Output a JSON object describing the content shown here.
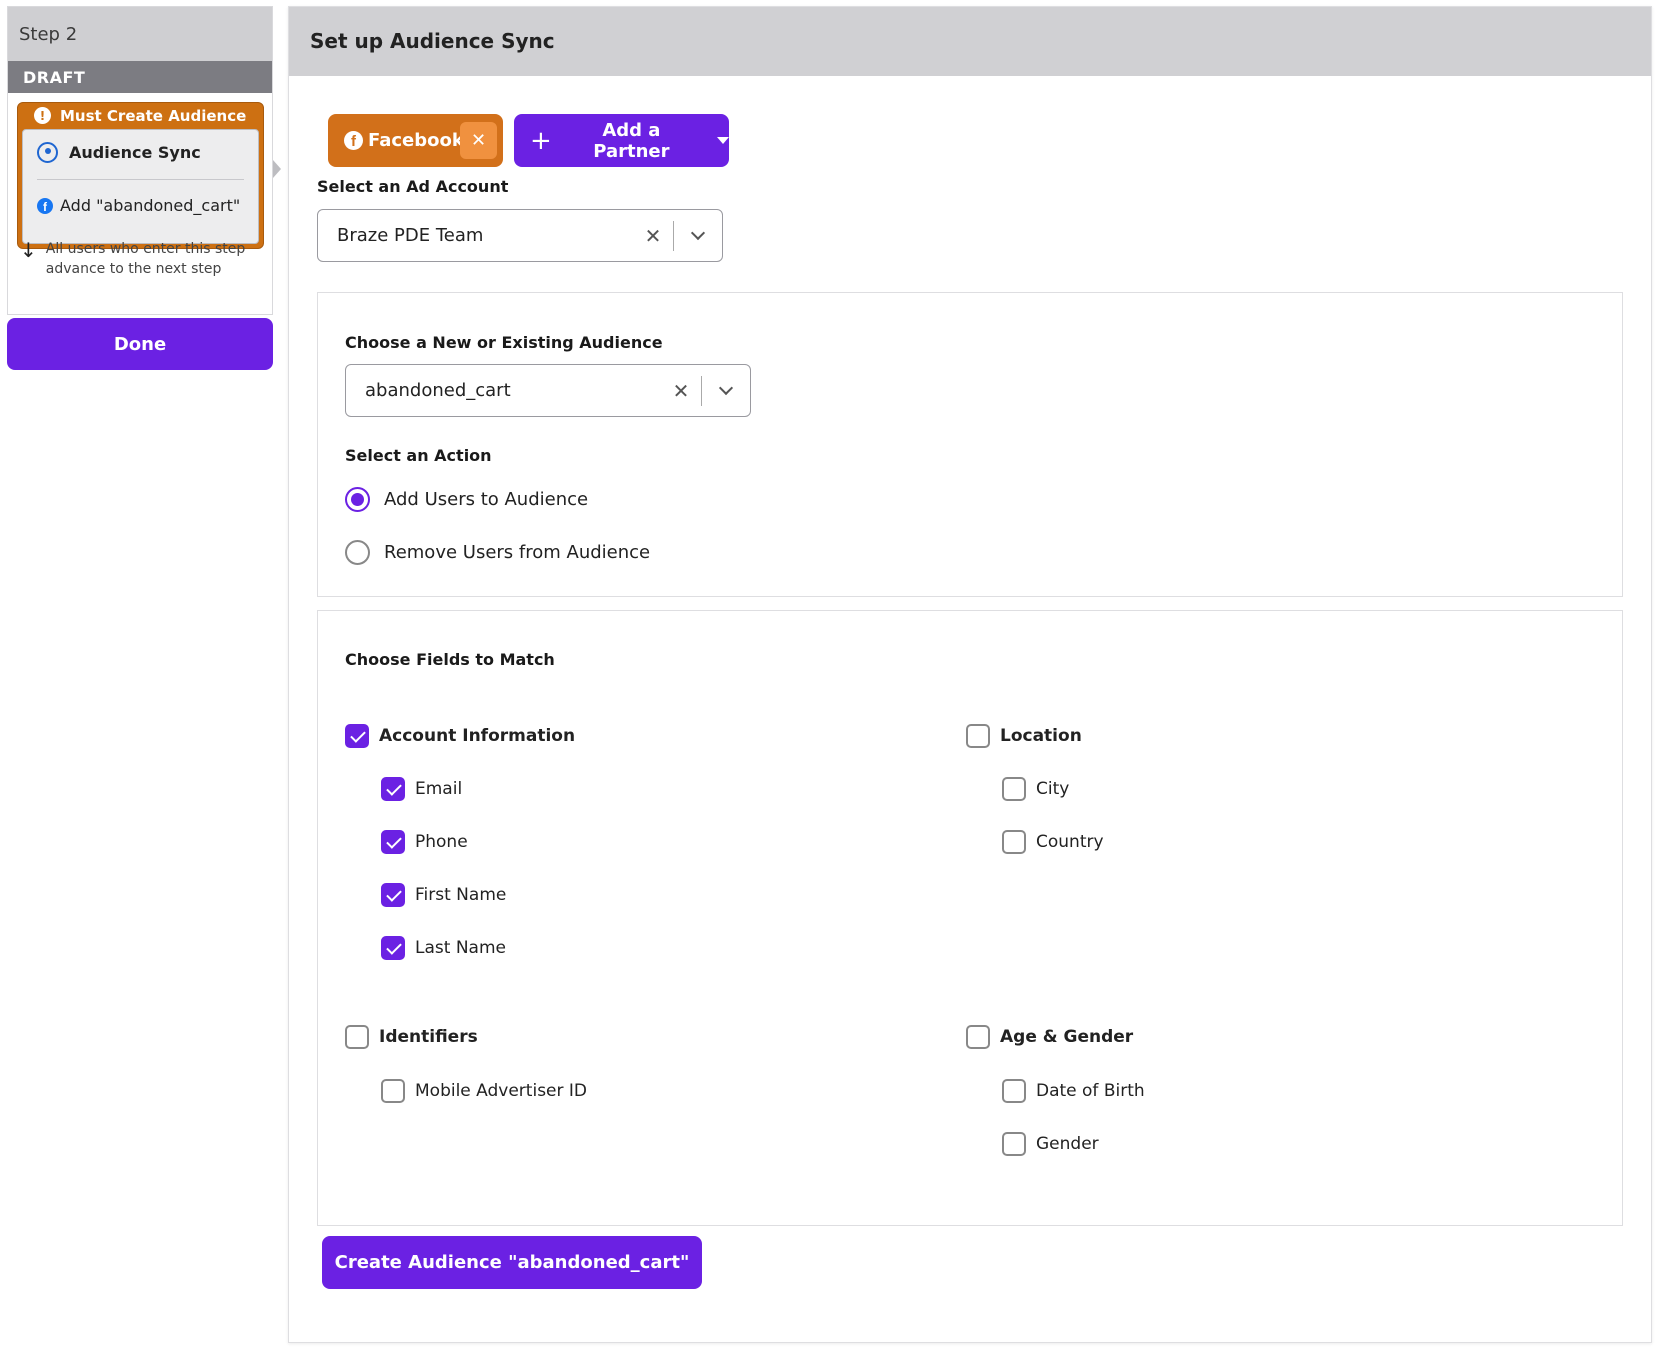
{
  "step": {
    "title": "Step 2",
    "status": "DRAFT",
    "warning": "Must Create Audience",
    "component_name": "Audience Sync",
    "action_summary": "Add \"abandoned_cart\"",
    "advance_text_line1": "All users who enter this step",
    "advance_text_line2": "advance to the next step",
    "done_label": "Done"
  },
  "main": {
    "title": "Set up Audience Sync",
    "partner_chip": "Facebook",
    "add_partner_label": "Add a Partner",
    "ad_account": {
      "label": "Select an Ad Account",
      "value": "Braze PDE Team"
    },
    "audience": {
      "label": "Choose a New or Existing Audience",
      "value": "abandoned_cart"
    },
    "action": {
      "label": "Select an Action",
      "options": [
        {
          "label": "Add Users to Audience",
          "selected": true
        },
        {
          "label": "Remove Users from Audience",
          "selected": false
        }
      ]
    },
    "fields": {
      "label": "Choose Fields to Match",
      "groups": {
        "account": {
          "label": "Account Information",
          "checked": true,
          "items": [
            {
              "label": "Email",
              "checked": true
            },
            {
              "label": "Phone",
              "checked": true
            },
            {
              "label": "First Name",
              "checked": true
            },
            {
              "label": "Last Name",
              "checked": true
            }
          ]
        },
        "location": {
          "label": "Location",
          "checked": false,
          "items": [
            {
              "label": "City",
              "checked": false
            },
            {
              "label": "Country",
              "checked": false
            }
          ]
        },
        "identifiers": {
          "label": "Identifiers",
          "checked": false,
          "items": [
            {
              "label": "Mobile Advertiser ID",
              "checked": false
            }
          ]
        },
        "age_gender": {
          "label": "Age & Gender",
          "checked": false,
          "items": [
            {
              "label": "Date of Birth",
              "checked": false
            },
            {
              "label": "Gender",
              "checked": false
            }
          ]
        }
      }
    },
    "create_label": "Create Audience \"abandoned_cart\""
  },
  "colors": {
    "accent": "#6b21e3",
    "warning": "#cd7012",
    "facebook": "#1877f2"
  }
}
